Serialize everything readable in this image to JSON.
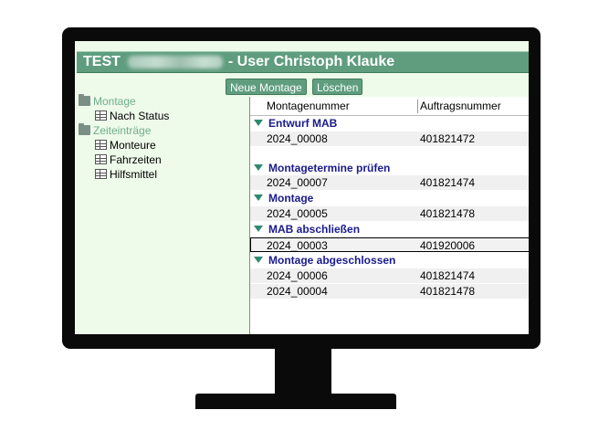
{
  "window": {
    "title_prefix": "TEST",
    "title_user": "- User Christoph Klauke"
  },
  "sidebar": {
    "items": [
      {
        "label": "Montage",
        "type": "folder",
        "icon": "folder-icon"
      },
      {
        "label": "Nach Status",
        "type": "view",
        "icon": "table-icon"
      },
      {
        "label": "Zeiteinträge",
        "type": "folder",
        "icon": "folder-icon"
      },
      {
        "label": "Monteure",
        "type": "view",
        "icon": "table-icon"
      },
      {
        "label": "Fahrzeiten",
        "type": "view",
        "icon": "table-icon"
      },
      {
        "label": "Hilfsmittel",
        "type": "view",
        "icon": "table-icon"
      }
    ]
  },
  "toolbar": {
    "new_label": "Neue Montage",
    "delete_label": "Löschen"
  },
  "table": {
    "columns": [
      "Montagenummer",
      "Auftragsnummer"
    ],
    "groups": [
      {
        "title": "Entwurf MAB",
        "rows": [
          [
            "2024_00008",
            "401821472"
          ]
        ]
      },
      {
        "title": "Montagetermine prüfen",
        "rows": [
          [
            "2024_00007",
            "401821474"
          ]
        ]
      },
      {
        "title": "Montage",
        "rows": [
          [
            "2024_00005",
            "401821478"
          ]
        ]
      },
      {
        "title": "MAB abschließen",
        "rows": [
          [
            "2024_00003",
            "401920006"
          ]
        ]
      },
      {
        "title": "Montage abgeschlossen",
        "rows": [
          [
            "2024_00006",
            "401821474"
          ],
          [
            "2024_00004",
            "401821478"
          ]
        ]
      }
    ]
  },
  "colors": {
    "accent": "#5f9d7e",
    "background": "#eefaea",
    "group_text": "#1a1a8c",
    "folder_text": "#6fae8e"
  }
}
